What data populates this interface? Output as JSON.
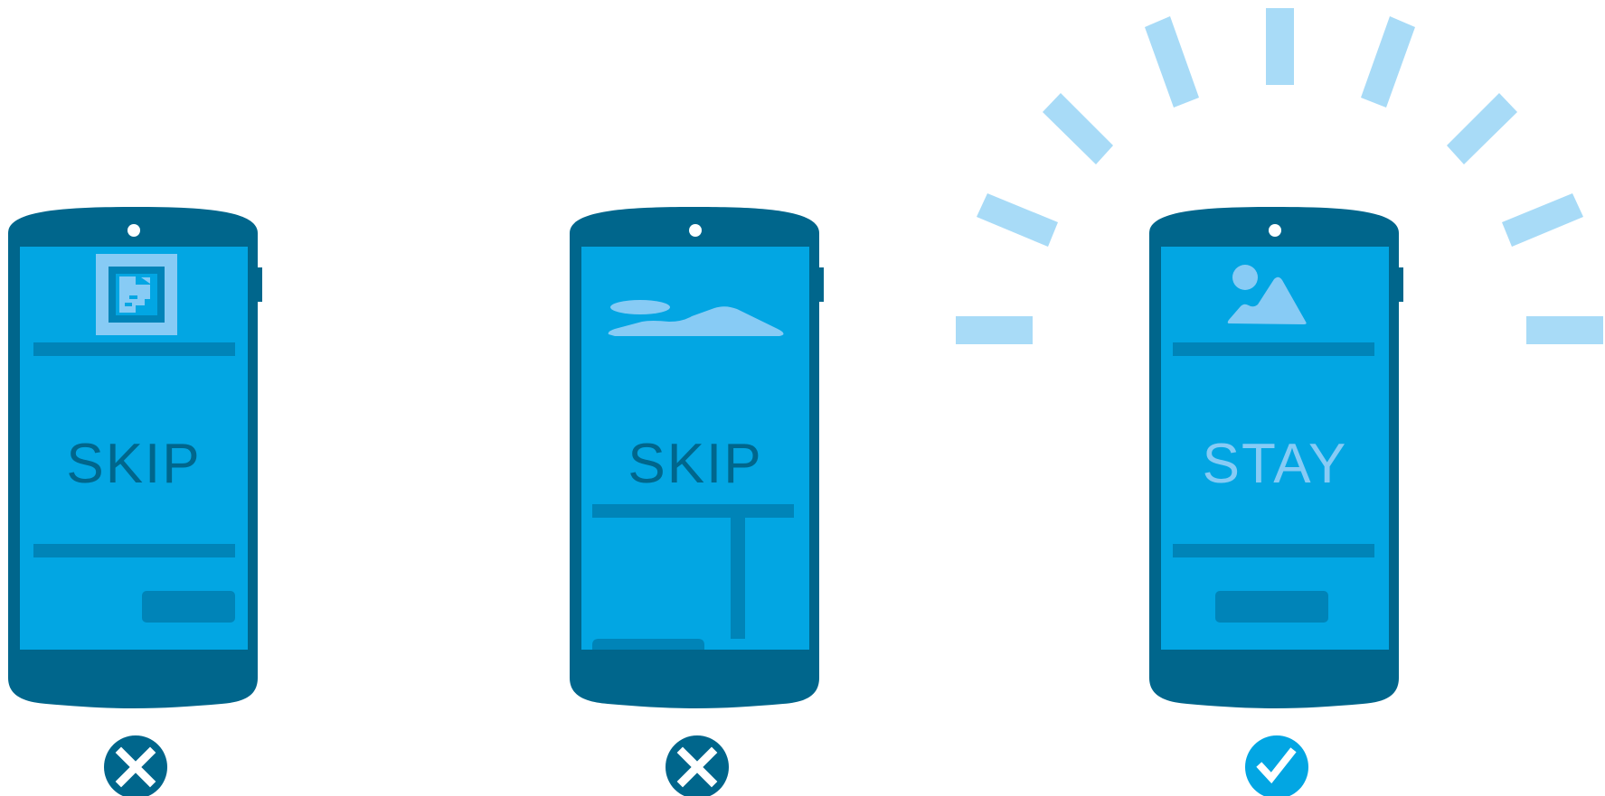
{
  "colors": {
    "background": "#ffffff",
    "phone_body": "#00668c",
    "screen": "#02a6e3",
    "screen_elements": "#0084b8",
    "light_accent": "#87cbf5",
    "light_ray": "#a8dbf7",
    "x_badge": "#00668c",
    "check_badge": "#02a6e3",
    "badge_mark": "#ffffff"
  },
  "panels": [
    {
      "id": "app-install-banner",
      "screen_text": "SKIP",
      "icon": "app-icon",
      "badge": "x-icon",
      "highlighted": false
    },
    {
      "id": "full-screen-interstitial",
      "screen_text": "SKIP",
      "icon": "landscape-icon",
      "badge": "x-icon",
      "highlighted": false
    },
    {
      "id": "inline-banner",
      "screen_text": "STAY",
      "icon": "image-icon",
      "badge": "check-icon",
      "highlighted": true
    }
  ]
}
